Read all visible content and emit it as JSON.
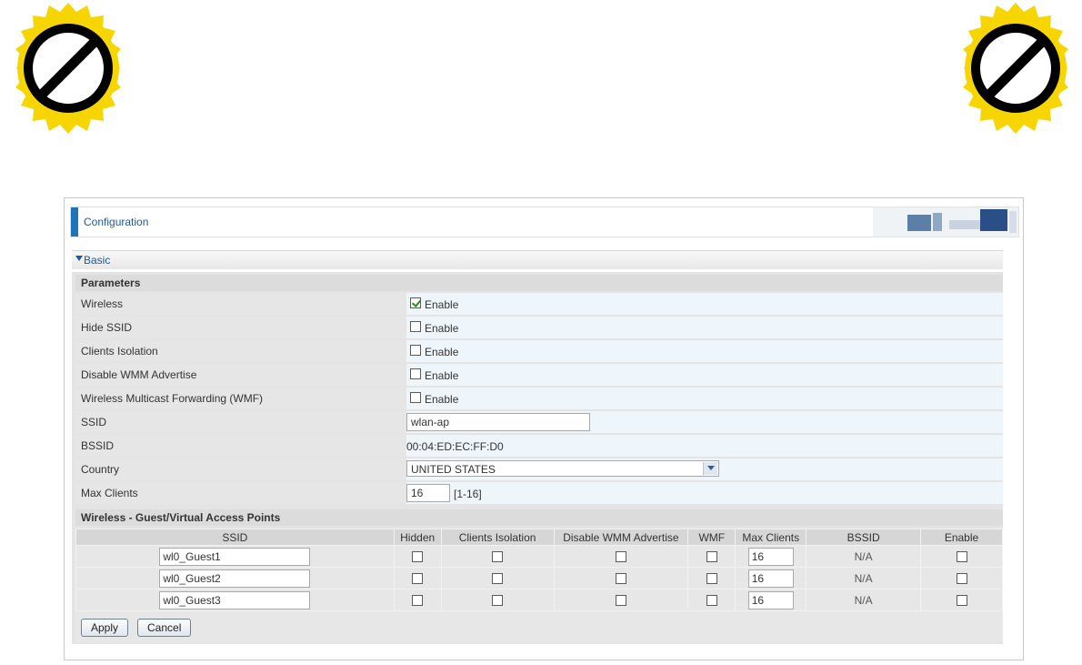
{
  "header": {
    "title": "Configuration"
  },
  "section": {
    "label": "Basic"
  },
  "parameters": {
    "heading": "Parameters",
    "wireless": {
      "label": "Wireless",
      "option": "Enable",
      "checked": true
    },
    "hide_ssid": {
      "label": "Hide SSID",
      "option": "Enable",
      "checked": false
    },
    "clients_isolation": {
      "label": "Clients Isolation",
      "option": "Enable",
      "checked": false
    },
    "disable_wmm": {
      "label": "Disable WMM Advertise",
      "option": "Enable",
      "checked": false
    },
    "wmf": {
      "label": "Wireless Multicast Forwarding (WMF)",
      "option": "Enable",
      "checked": false
    },
    "ssid": {
      "label": "SSID",
      "value": "wlan-ap"
    },
    "bssid": {
      "label": "BSSID",
      "value": "00:04:ED:EC:FF:D0"
    },
    "country": {
      "label": "Country",
      "value": "UNITED STATES"
    },
    "max_clients": {
      "label": "Max Clients",
      "value": "16",
      "range": "[1-16]"
    }
  },
  "guest": {
    "heading": "Wireless - Guest/Virtual Access Points",
    "columns": [
      "SSID",
      "Hidden",
      "Clients Isolation",
      "Disable WMM Advertise",
      "WMF",
      "Max Clients",
      "BSSID",
      "Enable"
    ],
    "rows": [
      {
        "ssid": "wl0_Guest1",
        "max_clients": "16",
        "bssid": "N/A"
      },
      {
        "ssid": "wl0_Guest2",
        "max_clients": "16",
        "bssid": "N/A"
      },
      {
        "ssid": "wl0_Guest3",
        "max_clients": "16",
        "bssid": "N/A"
      }
    ]
  },
  "buttons": {
    "apply": "Apply",
    "cancel": "Cancel"
  },
  "colors": {
    "accent": "#1f73b7",
    "seal": "#f6d500",
    "link": "#1c5a99"
  },
  "icons": {
    "seal": "prohibited-icon"
  }
}
